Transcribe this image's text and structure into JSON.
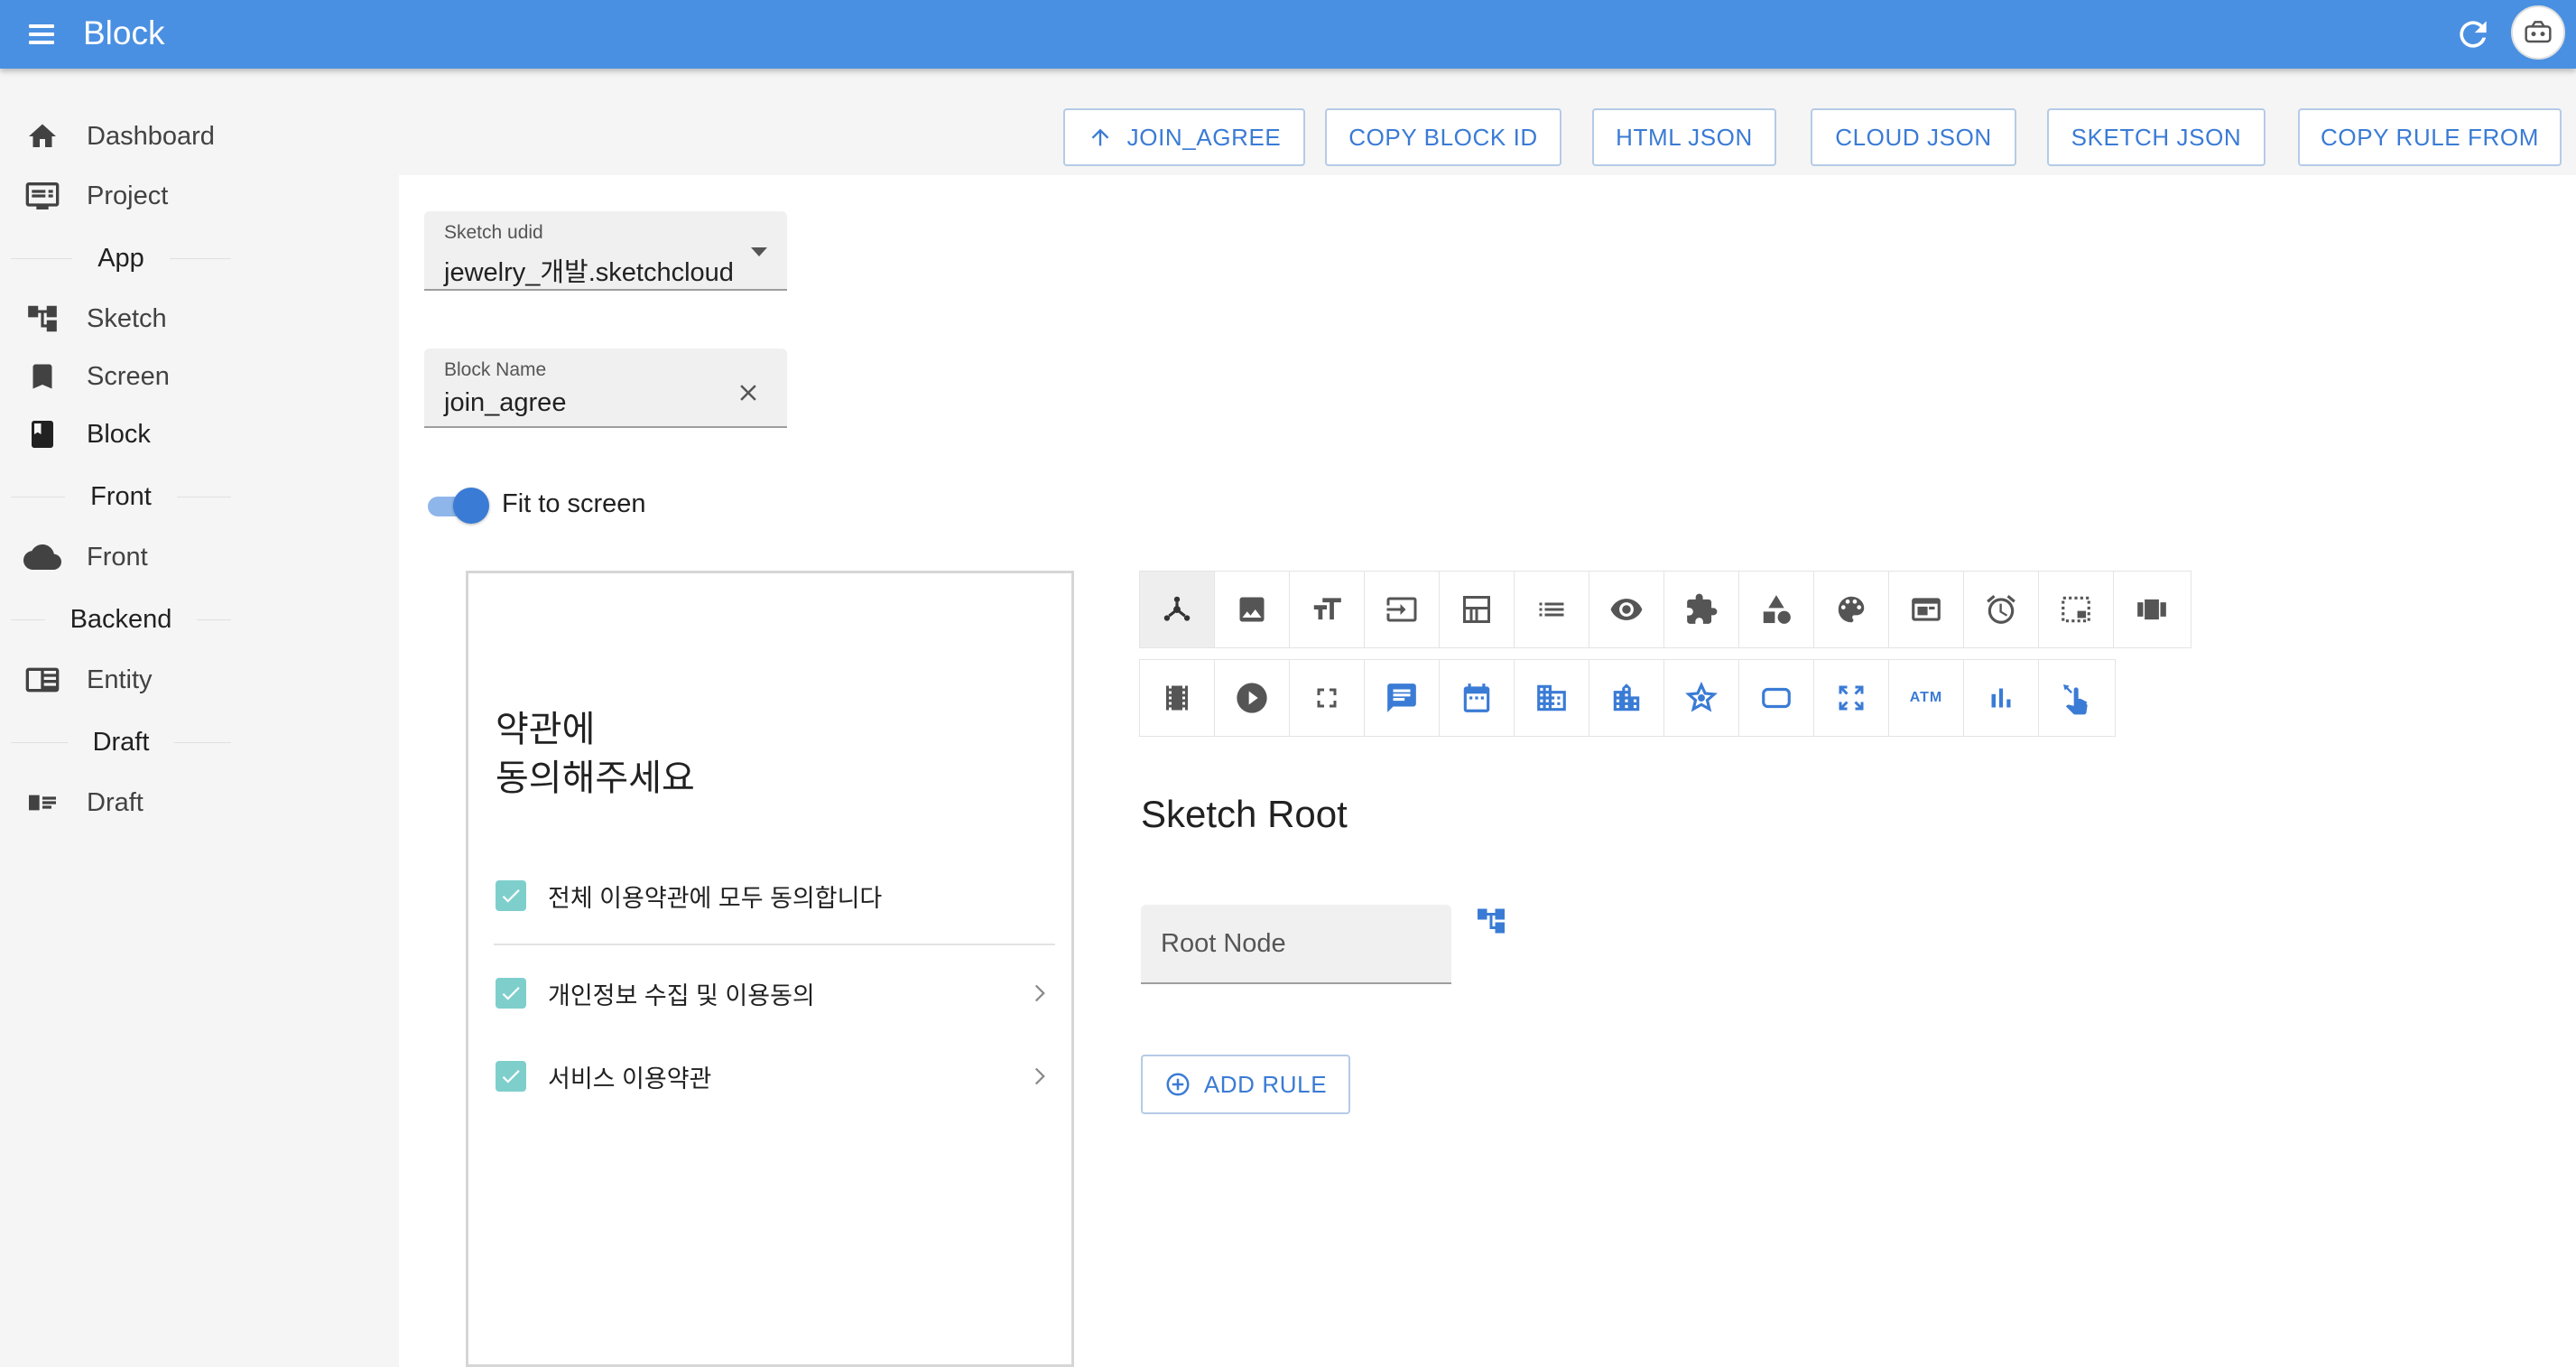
{
  "app": {
    "title": "Block"
  },
  "sidebar": {
    "items": [
      {
        "label": "Dashboard",
        "icon": "home-icon"
      },
      {
        "label": "Project",
        "icon": "project-list-icon"
      },
      {
        "label": "Sketch",
        "icon": "tree-structure-icon"
      },
      {
        "label": "Screen",
        "icon": "bookmark-icon"
      },
      {
        "label": "Block",
        "icon": "book-icon"
      },
      {
        "label": "Front",
        "icon": "cloud-icon"
      },
      {
        "label": "Entity",
        "icon": "table-icon"
      },
      {
        "label": "Draft",
        "icon": "id-card-icon"
      }
    ],
    "sections": [
      "App",
      "Front",
      "Backend",
      "Draft"
    ]
  },
  "toolbar": {
    "buttons": [
      "JOIN_AGREE",
      "COPY BLOCK ID",
      "HTML JSON",
      "CLOUD JSON",
      "SKETCH JSON",
      "COPY RULE FROM"
    ]
  },
  "form": {
    "sketch_udid": {
      "label": "Sketch udid",
      "value": "jewelry_개발.sketchcloud"
    },
    "block_name": {
      "label": "Block Name",
      "value": "join_agree"
    },
    "fit_to_screen": {
      "label": "Fit to screen",
      "on": true
    }
  },
  "preview": {
    "heading_line1": "약관에",
    "heading_line2": "동의해주세요",
    "items": [
      {
        "label": "전체 이용약관에 모두 동의합니다",
        "checked": true
      },
      {
        "label": "개인정보 수집 및 이용동의",
        "checked": true
      },
      {
        "label": "서비스 이용약관",
        "checked": true
      }
    ]
  },
  "component_icons": {
    "row1": [
      "hierarchy-icon",
      "image-icon",
      "text-size-icon",
      "input-icon",
      "layout-icon",
      "list-icon",
      "eye-icon",
      "puzzle-icon",
      "shapes-icon",
      "palette-icon",
      "web-layout-icon",
      "alarm-icon",
      "selection-icon",
      "carousel-icon"
    ],
    "row2": [
      "film-icon",
      "play-icon",
      "fullscreen-icon",
      "chat-icon",
      "calendar-icon",
      "building-icon",
      "city-icon",
      "star-icon",
      "rounded-rect-icon",
      "expand-icon",
      "atm-icon",
      "bar-chart-icon",
      "swipe-icon"
    ]
  },
  "sketch": {
    "title": "Sketch Root",
    "root_node_label": "Root Node",
    "add_rule_label": "ADD RULE",
    "atm_text": "ATM"
  },
  "colors": {
    "appbar": "#4a90e2",
    "accent": "#3a7bd5",
    "checkbox": "#7ecfcc"
  }
}
